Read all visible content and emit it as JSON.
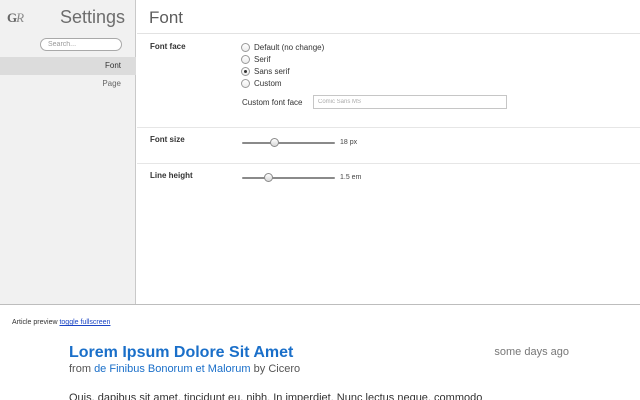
{
  "logo": {
    "g": "G",
    "r": "R"
  },
  "sidebar": {
    "title": "Settings",
    "search_placeholder": "Search...",
    "items": [
      {
        "label": "Font",
        "active": true
      },
      {
        "label": "Page",
        "active": false
      }
    ]
  },
  "main": {
    "title": "Font",
    "font_face": {
      "label": "Font face",
      "options": [
        {
          "label": "Default (no change)",
          "checked": false
        },
        {
          "label": "Serif",
          "checked": false
        },
        {
          "label": "Sans serif",
          "checked": true
        },
        {
          "label": "Custom",
          "checked": false
        }
      ],
      "custom_label": "Custom font face",
      "custom_placeholder": "Comic Sans MS"
    },
    "font_size": {
      "label": "Font size",
      "value_text": "18 px",
      "level": 0.33
    },
    "line_height": {
      "label": "Line height",
      "value_text": "1.5 em",
      "level": 0.26
    }
  },
  "preview": {
    "label": "Article preview",
    "toggle": "toggle fullscreen",
    "article": {
      "title": "Lorem Ipsum Dolore Sit Amet",
      "time": "some days ago",
      "from": "from",
      "source": "de Finibus Bonorum et Malorum",
      "by": "by Cicero",
      "body": "Quis, dapibus sit amet, tincidunt eu, nibh. In imperdiet. Nunc lectus neque, commodo"
    }
  }
}
